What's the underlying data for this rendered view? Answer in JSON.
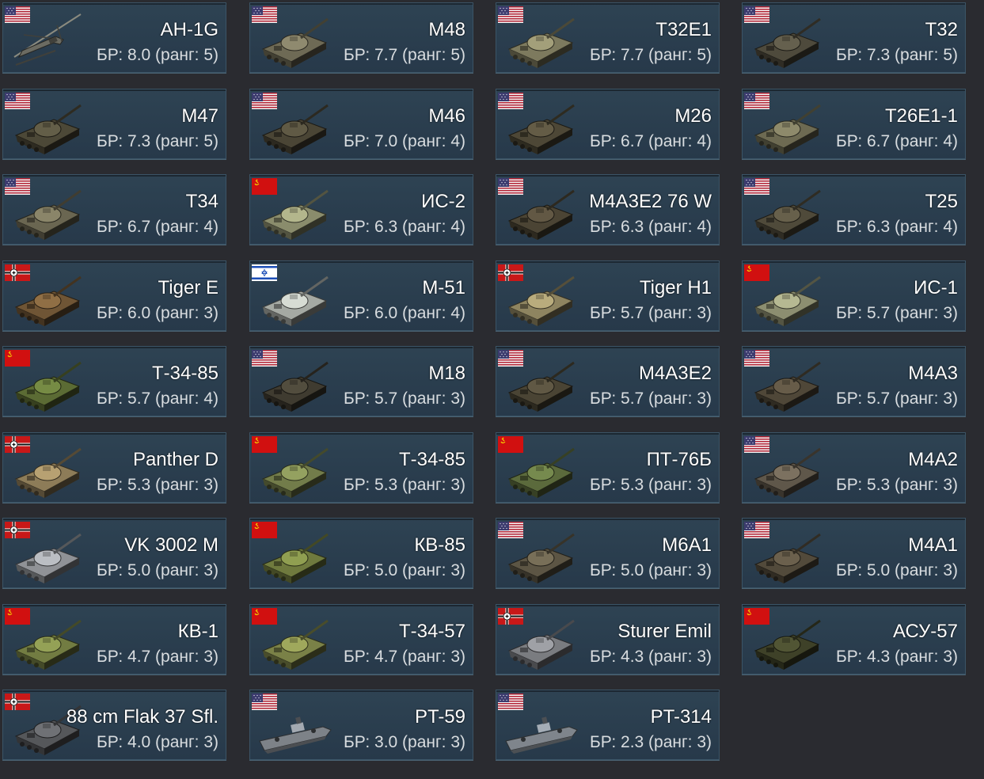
{
  "colors": {
    "card_bg": "#2b3f4f",
    "card_border": "#3b5466",
    "page_bg": "#2a2b30",
    "name_text": "#ffffff",
    "br_text": "#d9dde0"
  },
  "vehicles": [
    {
      "name": "AH-1G",
      "br": "БР: 8.0 (ранг: 5)",
      "flag": "usa-flag",
      "kind": "helicopter-icon",
      "camo": "#6b6b62"
    },
    {
      "name": "M48",
      "br": "БР: 7.7 (ранг: 5)",
      "flag": "usa-flag",
      "kind": "tank-icon",
      "camo": "#6e6a55"
    },
    {
      "name": "T32E1",
      "br": "БР: 7.7 (ранг: 5)",
      "flag": "usa-flag",
      "kind": "tank-icon",
      "camo": "#7d7a5e"
    },
    {
      "name": "T32",
      "br": "БР: 7.3 (ранг: 5)",
      "flag": "usa-flag",
      "kind": "tank-icon",
      "camo": "#4e4a3c"
    },
    {
      "name": "M47",
      "br": "БР: 7.3 (ранг: 5)",
      "flag": "usa-flag",
      "kind": "tank-icon",
      "camo": "#4c4837"
    },
    {
      "name": "M46",
      "br": "БР: 7.0 (ранг: 4)",
      "flag": "usa-flag",
      "kind": "tank-icon",
      "camo": "#4a4535"
    },
    {
      "name": "M26",
      "br": "БР: 6.7 (ранг: 4)",
      "flag": "usa-flag",
      "kind": "tank-icon",
      "camo": "#4d4736"
    },
    {
      "name": "T26E1-1",
      "br": "БР: 6.7 (ранг: 4)",
      "flag": "usa-flag",
      "kind": "tank-icon",
      "camo": "#6d6a52"
    },
    {
      "name": "T34",
      "br": "БР: 6.7 (ранг: 4)",
      "flag": "usa-flag",
      "kind": "tank-icon",
      "camo": "#6a6651"
    },
    {
      "name": "ИС-2",
      "br": "БР: 6.3 (ранг: 4)",
      "flag": "ussr-flag",
      "kind": "tank-icon",
      "camo": "#8a8c6c"
    },
    {
      "name": "M4A3E2 76 W",
      "br": "БР: 6.3 (ранг: 4)",
      "flag": "usa-flag",
      "kind": "tank-icon",
      "camo": "#4b4434"
    },
    {
      "name": "T25",
      "br": "БР: 6.3 (ранг: 4)",
      "flag": "usa-flag",
      "kind": "tank-icon",
      "camo": "#4f4a3a"
    },
    {
      "name": "Tiger E",
      "br": "БР: 6.0 (ранг: 3)",
      "flag": "germany-flag",
      "kind": "tank-icon",
      "camo": "#6f5535"
    },
    {
      "name": "M-51",
      "br": "БР: 6.0 (ранг: 4)",
      "flag": "israel-flag",
      "kind": "tank-icon",
      "camo": "#a5a9a3"
    },
    {
      "name": "Tiger H1",
      "br": "БР: 5.7 (ранг: 3)",
      "flag": "germany-flag",
      "kind": "tank-icon",
      "camo": "#8e8460"
    },
    {
      "name": "ИС-1",
      "br": "БР: 5.7 (ранг: 3)",
      "flag": "ussr-flag",
      "kind": "tank-icon",
      "camo": "#8c8e70"
    },
    {
      "name": "Т-34-85",
      "br": "БР: 5.7 (ранг: 4)",
      "flag": "ussr-flag",
      "kind": "tank-icon",
      "camo": "#5b6b34"
    },
    {
      "name": "M18",
      "br": "БР: 5.7 (ранг: 3)",
      "flag": "usa-flag",
      "kind": "tank-icon",
      "camo": "#3f3b30"
    },
    {
      "name": "M4A3E2",
      "br": "БР: 5.7 (ранг: 3)",
      "flag": "usa-flag",
      "kind": "tank-icon",
      "camo": "#4a4434"
    },
    {
      "name": "M4A3",
      "br": "БР: 5.7 (ранг: 3)",
      "flag": "usa-flag",
      "kind": "tank-icon",
      "camo": "#4f4738"
    },
    {
      "name": "Panther D",
      "br": "БР: 5.3 (ранг: 3)",
      "flag": "germany-flag",
      "kind": "tank-icon",
      "camo": "#8d7c58"
    },
    {
      "name": "Т-34-85",
      "br": "БР: 5.3 (ранг: 3)",
      "flag": "ussr-flag",
      "kind": "tank-icon",
      "camo": "#727c4a"
    },
    {
      "name": "ПТ-76Б",
      "br": "БР: 5.3 (ранг: 3)",
      "flag": "ussr-flag",
      "kind": "tank-icon",
      "camo": "#5b6a3c"
    },
    {
      "name": "M4A2",
      "br": "БР: 5.3 (ранг: 3)",
      "flag": "usa-flag",
      "kind": "tank-icon",
      "camo": "#5f574a"
    },
    {
      "name": "VK 3002 M",
      "br": "БР: 5.0 (ранг: 3)",
      "flag": "germany-flag",
      "kind": "tank-icon",
      "camo": "#909296"
    },
    {
      "name": "КВ-85",
      "br": "БР: 5.0 (ранг: 3)",
      "flag": "ussr-flag",
      "kind": "tank-icon",
      "camo": "#6f7a3e"
    },
    {
      "name": "M6A1",
      "br": "БР: 5.0 (ранг: 3)",
      "flag": "usa-flag",
      "kind": "tank-icon",
      "camo": "#5c5544"
    },
    {
      "name": "M4A1",
      "br": "БР: 5.0 (ранг: 3)",
      "flag": "usa-flag",
      "kind": "tank-icon",
      "camo": "#524a3b"
    },
    {
      "name": "КВ-1",
      "br": "БР: 4.7 (ранг: 3)",
      "flag": "ussr-flag",
      "kind": "tank-icon",
      "camo": "#727c42"
    },
    {
      "name": "Т-34-57",
      "br": "БР: 4.7 (ранг: 3)",
      "flag": "ussr-flag",
      "kind": "tank-icon",
      "camo": "#7a8147"
    },
    {
      "name": "Sturer Emil",
      "br": "БР: 4.3 (ранг: 3)",
      "flag": "germany-flag",
      "kind": "tank-icon",
      "camo": "#7a7c80"
    },
    {
      "name": "АСУ-57",
      "br": "БР: 4.3 (ранг: 3)",
      "flag": "ussr-flag",
      "kind": "tank-icon",
      "camo": "#3e4128"
    },
    {
      "name": "88 cm Flak 37 Sfl.",
      "br": "БР: 4.0 (ранг: 3)",
      "flag": "germany-flag",
      "kind": "tank-icon",
      "camo": "#55575a"
    },
    {
      "name": "PT-59",
      "br": "БР: 3.0 (ранг: 3)",
      "flag": "usa-flag",
      "kind": "boat-icon",
      "camo": "#7d8288"
    },
    {
      "name": "PT-314",
      "br": "БР: 2.3 (ранг: 3)",
      "flag": "usa-flag",
      "kind": "boat-icon",
      "camo": "#7f858c"
    }
  ]
}
